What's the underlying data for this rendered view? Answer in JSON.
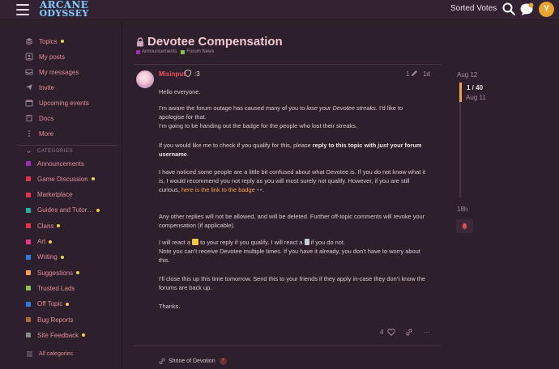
{
  "header": {
    "logo_line1": "ARCANE",
    "logo_line2": "ODYSSEY",
    "sorted_votes": "Sorted Votes",
    "avatar_letter": "Y"
  },
  "sidebar": {
    "nav": [
      {
        "label": "Topics",
        "icon": "topics-icon",
        "dot": true
      },
      {
        "label": "My posts",
        "icon": "user-icon",
        "dot": false
      },
      {
        "label": "My messages",
        "icon": "inbox-icon",
        "dot": false
      },
      {
        "label": "Invite",
        "icon": "paper-plane-icon",
        "dot": false
      },
      {
        "label": "Upcoming events",
        "icon": "calendar-icon",
        "dot": false
      },
      {
        "label": "Docs",
        "icon": "book-icon",
        "dot": false
      },
      {
        "label": "More",
        "icon": "vertical-dots-icon",
        "dot": false
      }
    ],
    "categories_label": "CATEGORIES",
    "categories": [
      {
        "label": "Announcements",
        "color": "#9b2fb5",
        "dot": false
      },
      {
        "label": "Game Discussion",
        "color": "#e0354a",
        "dot": true
      },
      {
        "label": "Marketplace",
        "color": "#e0354a",
        "dot": false
      },
      {
        "label": "Guides and Tutor…",
        "color": "#1fb59a",
        "dot": true
      },
      {
        "label": "Clans",
        "color": "#e0354a",
        "dot": true
      },
      {
        "label": "Art",
        "color": "#e63a86",
        "dot": true
      },
      {
        "label": "Writing",
        "color": "#2d7ce0",
        "dot": true
      },
      {
        "label": "Suggestions",
        "color": "#f2a14a",
        "dot": true
      },
      {
        "label": "Trusted Lads",
        "color": "#8bc34a",
        "dot": false
      },
      {
        "label": "Off Topic",
        "color": "#2d7ce0",
        "dot": true
      },
      {
        "label": "Bug Reports",
        "color": "#b06a3a",
        "dot": false
      },
      {
        "label": "Site Feedback",
        "color": "#8c8c8c",
        "dot": true
      }
    ],
    "all_categories": "All categories"
  },
  "topic": {
    "title": "Devotee Compensation",
    "crumbs": [
      {
        "label": "Announcements",
        "color": "#9b2fb5"
      },
      {
        "label": "Forum News",
        "color": "#8bc34a"
      }
    ]
  },
  "post": {
    "username": "Misinput",
    "flair": ":3",
    "edit_count": "1",
    "age": "1d",
    "p1": "Hello everyone.",
    "p2a": "I’m aware the forum outage has caused many of you to ",
    "p2b": "lose your Devotee streaks",
    "p2c": ". I’d like to apologise for that.",
    "p2d": "I’m going to be handing out the badge for the people who lost their streaks.",
    "p3a": "If you would like me to check if you qualify for this, please ",
    "p3b": "reply to this topic with ",
    "p3c": "just",
    "p3d": " your forum username",
    "p3e": ".",
    "p4a": "I have noticed some people are a little bit confused about what Devotee is. If you do not know what it is, I would recommend you not reply as you will most surely not qualify. However, if you are still curious, ",
    "p4link": "here is the link to the badge",
    "p4b": ".",
    "p5": "Any other replies will not be allowed, and will be deleted. Further off-topic comments will revoke your compensation (if applicable).",
    "p6a": "I will react a ",
    "p6b": " to your reply if you qualify. I will react a ",
    "p6c": " if you do not.",
    "p6d": "Note you can’t receive Devotee multiple times. If you have it already, you don’t have to worry about this.",
    "p7": "I’ll close this up this time tomorrow. Send this to your friends if they apply in-case they don’t know the forums are back up.",
    "p8": "Thanks.",
    "likes": "4",
    "more": "…"
  },
  "related": {
    "label": "Shrine of Devotion",
    "count": "7"
  },
  "timeline": {
    "top_date": "Aug 12",
    "position": "1 / 40",
    "position_date": "Aug 11",
    "bottom_date": "18h"
  },
  "colors": {
    "background": "#2e1f2c",
    "accent_orange": "#f2a14a",
    "link_pink": "#e08c9a",
    "username_red": "#ec4f5e"
  }
}
